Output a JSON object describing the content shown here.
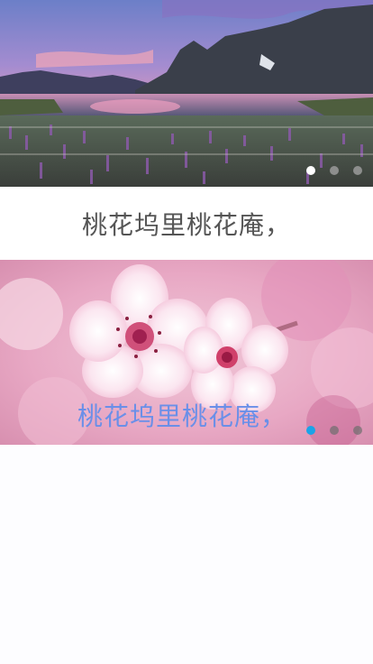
{
  "banner_top": {
    "image_alt": "mountain-lake-landscape",
    "pager": {
      "count": 3,
      "active": 0
    }
  },
  "caption_top": {
    "text": "桃花坞里桃花庵，"
  },
  "banner_bottom": {
    "image_alt": "peach-blossom-photo",
    "caption": "桃花坞里桃花庵，",
    "pager": {
      "count": 3,
      "active": 0
    }
  },
  "colors": {
    "caption_text": "#555555",
    "overlay_caption": "#6a8fe8",
    "pager_active_blue": "#1aa3e8",
    "pager_active_white": "#ffffff"
  }
}
